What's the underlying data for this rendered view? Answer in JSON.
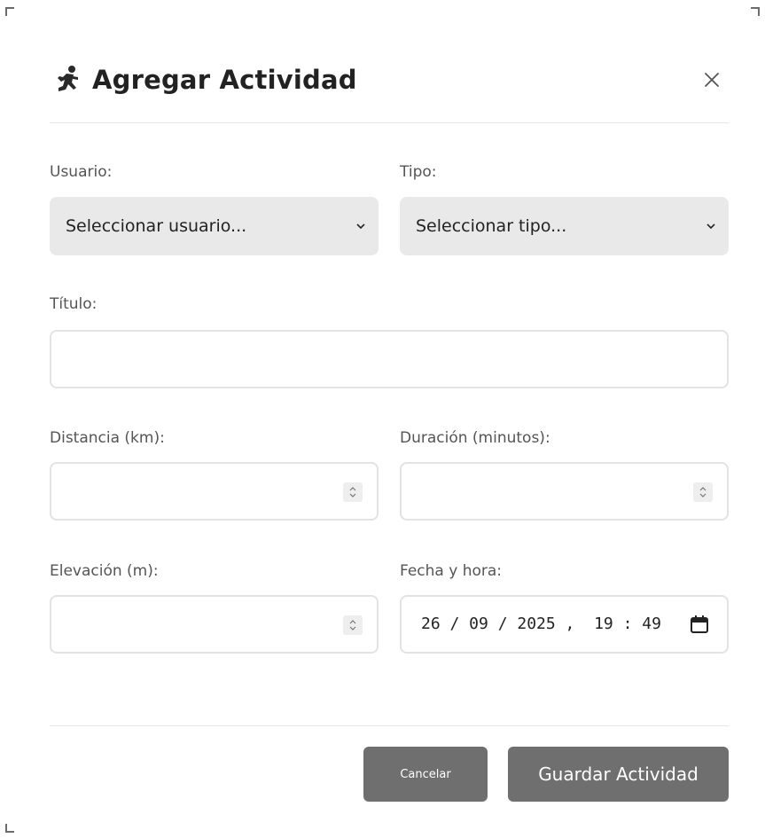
{
  "modal": {
    "title": "Agregar Actividad",
    "title_icon": "runner-icon",
    "close_label": "×"
  },
  "form": {
    "usuario": {
      "label": "Usuario:",
      "selected": "Seleccionar usuario..."
    },
    "tipo": {
      "label": "Tipo:",
      "selected": "Seleccionar tipo..."
    },
    "titulo": {
      "label": "Título:",
      "value": "",
      "placeholder": ""
    },
    "distancia": {
      "label": "Distancia (km):",
      "value": ""
    },
    "duracion": {
      "label": "Duración (minutos):",
      "value": ""
    },
    "elevacion": {
      "label": "Elevación (m):",
      "value": ""
    },
    "fecha": {
      "label": "Fecha y hora:",
      "value": "26/09/2025, 19:49",
      "display": "26 / 09 / 2025 ,  19 : 49"
    }
  },
  "footer": {
    "cancel_label": "Cancelar",
    "save_label": "Guardar Actividad"
  },
  "colors": {
    "button_bg": "#6f6f6f",
    "select_bg": "#e9e9e9",
    "input_border": "#e3e3e3"
  }
}
